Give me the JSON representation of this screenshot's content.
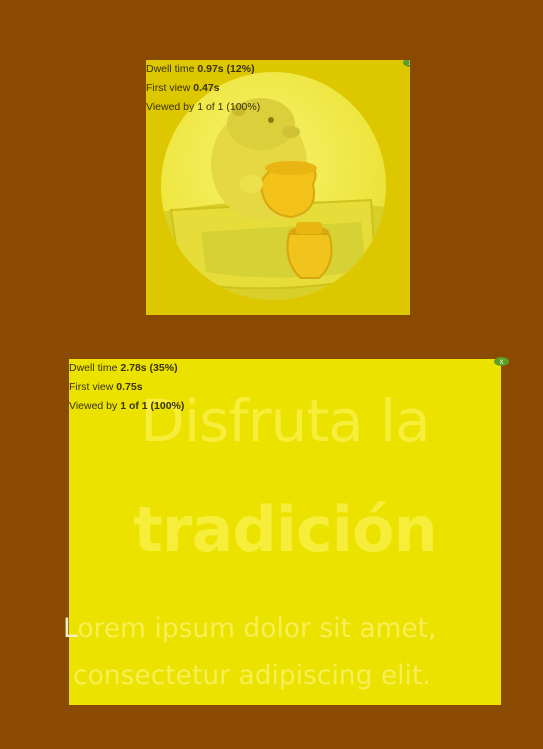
{
  "colors": {
    "background": "#8a4b00",
    "image_overlay": "#dcc700",
    "text_overlay": "#ece200",
    "close_badge": "#5c9e2a"
  },
  "image_aoi": {
    "dwell_label": "Dwell time",
    "dwell_value": "0.97s (12%)",
    "first_view_label": "First view",
    "first_view_value": "0.47s",
    "viewed_by_label": "Viewed by",
    "viewed_by_value": "1 of 1 (100%)",
    "close_label": "x",
    "image_icon": "capybara-with-clay-pot-illustration"
  },
  "text_aoi": {
    "dwell_label": "Dwell time",
    "dwell_value": "2.78s (35%)",
    "first_view_label": "First view",
    "first_view_value": "0.75s",
    "viewed_by_label": "Viewed by",
    "viewed_by_value": "1 of 1 (100%)",
    "close_label": "x",
    "headline_line1": "Disfruta la",
    "headline_line2": "tradición",
    "subtext_first_letter": "L",
    "subtext_line1_rest": "orem ipsum dolor sit amet,",
    "subtext_line2": "consectetur adipiscing elit."
  }
}
